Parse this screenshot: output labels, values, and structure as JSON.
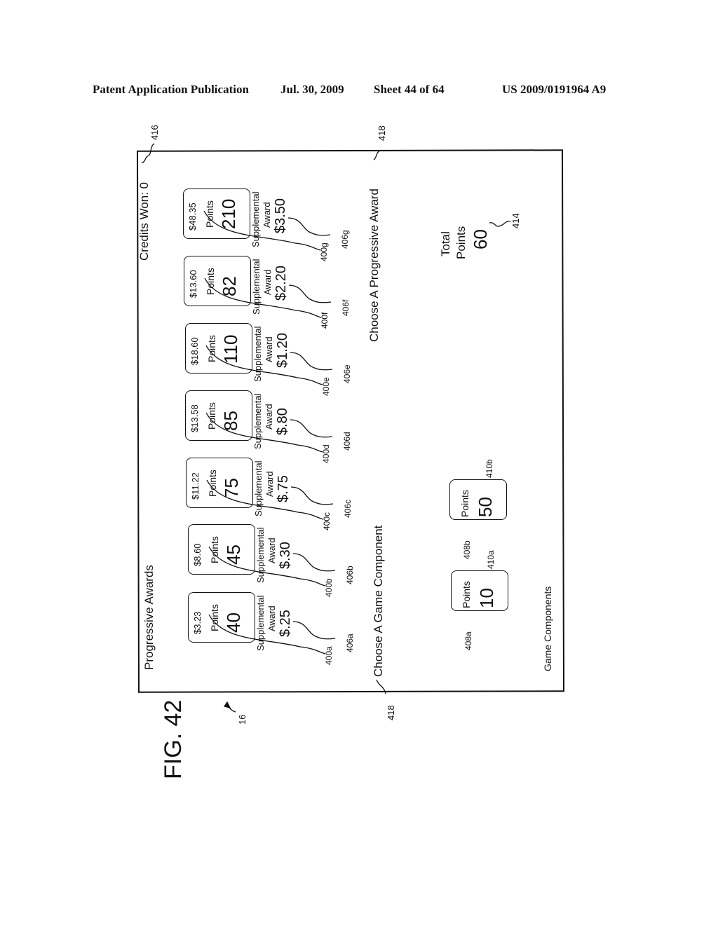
{
  "header": {
    "publication": "Patent Application Publication",
    "date": "Jul. 30, 2009",
    "sheet": "Sheet 44 of 64",
    "number": "US 2009/0191964 A9"
  },
  "figure": {
    "label": "FIG. 42",
    "ref_display": "16"
  },
  "screen": {
    "progressive_title": "Progressive Awards",
    "credits_won": "Credits Won: 0",
    "credits_ref": "416",
    "choose_component": "Choose A Game Component",
    "choose_progressive": "Choose A Progressive Award",
    "choose_ref": "418",
    "game_components_title": "Game Components",
    "total": {
      "label1": "Total",
      "label2": "Points",
      "value": "60",
      "ref": "414"
    },
    "awards": [
      {
        "amount": "$3.23",
        "points_label": "Points",
        "points": "40",
        "supp_label1": "Supplemental",
        "supp_label2": "Award",
        "supp": "$.25",
        "ref_award": "400a",
        "ref_supp": "406a"
      },
      {
        "amount": "$8.60",
        "points_label": "Points",
        "points": "45",
        "supp_label1": "Supplemental",
        "supp_label2": "Award",
        "supp": "$.30",
        "ref_award": "400b",
        "ref_supp": "406b"
      },
      {
        "amount": "$11.22",
        "points_label": "Points",
        "points": "75",
        "supp_label1": "Supplemental",
        "supp_label2": "Award",
        "supp": "$.75",
        "ref_award": "400c",
        "ref_supp": "406c"
      },
      {
        "amount": "$13.58",
        "points_label": "Points",
        "points": "85",
        "supp_label1": "Supplemental",
        "supp_label2": "Award",
        "supp": "$.80",
        "ref_award": "400d",
        "ref_supp": "406d"
      },
      {
        "amount": "$18.60",
        "points_label": "Points",
        "points": "110",
        "supp_label1": "Supplemental",
        "supp_label2": "Award",
        "supp": "$1.20",
        "ref_award": "400e",
        "ref_supp": "406e"
      },
      {
        "amount": "$13.60",
        "points_label": "Points",
        "points": "82",
        "supp_label1": "Supplemental",
        "supp_label2": "Award",
        "supp": "$2.20",
        "ref_award": "400f",
        "ref_supp": "406f"
      },
      {
        "amount": "$48.35",
        "points_label": "Points",
        "points": "210",
        "supp_label1": "Supplemental",
        "supp_label2": "Award",
        "supp": "$3.50",
        "ref_award": "400g",
        "ref_supp": "406g"
      }
    ],
    "components": [
      {
        "points_label": "Points",
        "points": "10",
        "ref_box": "408a",
        "ref_value": "410a"
      },
      {
        "points_label": "Points",
        "points": "50",
        "ref_box": "408b",
        "ref_value": "410b"
      }
    ]
  }
}
